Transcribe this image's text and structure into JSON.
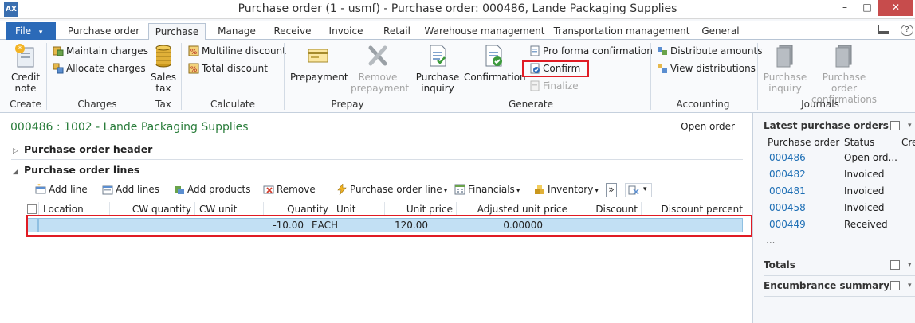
{
  "window": {
    "title": "Purchase order (1 - usmf) - Purchase order: 000486, Lande Packaging Supplies",
    "app_badge": "AX",
    "min": "–",
    "max": "□",
    "close": "✕"
  },
  "tabs": {
    "file": "File",
    "file_arrow": "▾",
    "items": [
      "Purchase order",
      "Purchase",
      "Manage",
      "Receive",
      "Invoice",
      "Retail",
      "Warehouse management",
      "Transportation management",
      "General"
    ],
    "help": "?"
  },
  "ribbon": {
    "create": {
      "credit_note_1": "Credit",
      "credit_note_2": "note",
      "label": "Create"
    },
    "charges": {
      "maintain": "Maintain charges",
      "allocate": "Allocate charges",
      "label": "Charges"
    },
    "tax": {
      "sales_tax_1": "Sales",
      "sales_tax_2": "tax",
      "label": "Tax"
    },
    "calculate": {
      "multiline": "Multiline discount",
      "total": "Total discount",
      "label": "Calculate"
    },
    "prepay": {
      "prepayment": "Prepayment",
      "remove_1": "Remove",
      "remove_2": "prepayment",
      "label": "Prepay"
    },
    "generate": {
      "inquiry_1": "Purchase",
      "inquiry_2": "inquiry",
      "confirmation": "Confirmation",
      "proforma": "Pro forma confirmation",
      "confirm": "Confirm",
      "finalize": "Finalize",
      "label": "Generate"
    },
    "accounting": {
      "distribute": "Distribute amounts",
      "view": "View distributions",
      "label": "Accounting"
    },
    "journals": {
      "inquiry_1": "Purchase",
      "inquiry_2": "inquiry",
      "confirmations_1": "Purchase order",
      "confirmations_2": "confirmations",
      "label": "Journals"
    }
  },
  "main": {
    "title": "000486 : 1002 - Lande Packaging Supplies",
    "status": "Open order",
    "header_section": "Purchase order header",
    "lines_section": "Purchase order lines",
    "collapsed_arrow": "▷",
    "expanded_arrow": "◢",
    "toolbar": {
      "add_line": "Add line",
      "add_lines": "Add lines",
      "add_products": "Add products",
      "remove": "Remove",
      "po_line": "Purchase order line",
      "financials": "Financials",
      "inventory": "Inventory",
      "more": "»",
      "dropdown": "▾"
    },
    "grid": {
      "columns": [
        "Location",
        "CW quantity",
        "CW unit",
        "Quantity",
        "Unit",
        "Unit price",
        "Adjusted unit price",
        "Discount",
        "Discount percent"
      ],
      "row": {
        "location": "",
        "cw_quantity": "",
        "cw_unit": "",
        "quantity": "-10.00",
        "unit": "EACH",
        "unit_price": "120.00",
        "adjusted_unit_price": "0.00000",
        "discount": "",
        "discount_percent": ""
      }
    }
  },
  "right_pane": {
    "latest_title": "Latest purchase orders",
    "col_po": "Purchase order",
    "col_status": "Status",
    "col_cre": "Cre",
    "orders": [
      {
        "id": "000486",
        "status": "Open ord..."
      },
      {
        "id": "000482",
        "status": "Invoiced"
      },
      {
        "id": "000481",
        "status": "Invoiced"
      },
      {
        "id": "000458",
        "status": "Invoiced"
      },
      {
        "id": "000449",
        "status": "Received"
      }
    ],
    "more": "...",
    "totals_title": "Totals",
    "encumbrance_title": "Encumbrance summary",
    "chevron": "▾"
  },
  "colors": {
    "accent": "#2b6ab8",
    "highlight": "#e01b24",
    "title_green": "#2a7d3b",
    "link": "#1e6fb5",
    "row_selected": "#c2e0f4"
  }
}
